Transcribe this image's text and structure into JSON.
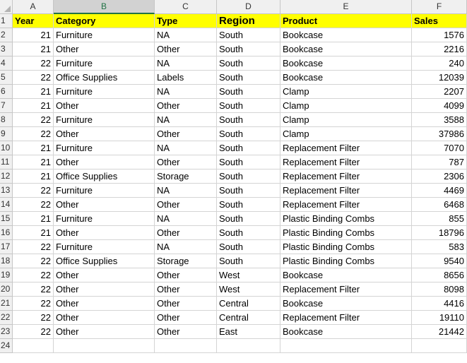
{
  "columns": [
    "A",
    "B",
    "C",
    "D",
    "E",
    "F"
  ],
  "header": {
    "year": "Year",
    "category": "Category",
    "type": "Type",
    "region": "Region",
    "product": "Product",
    "sales": "Sales"
  },
  "rows": [
    {
      "year": "21",
      "category": "Furniture",
      "type": "NA",
      "region": "South",
      "product": "Bookcase",
      "sales": "1576"
    },
    {
      "year": "21",
      "category": "Other",
      "type": "Other",
      "region": "South",
      "product": "Bookcase",
      "sales": "2216"
    },
    {
      "year": "22",
      "category": "Furniture",
      "type": "NA",
      "region": "South",
      "product": "Bookcase",
      "sales": "240"
    },
    {
      "year": "22",
      "category": "Office Supplies",
      "type": "Labels",
      "region": "South",
      "product": "Bookcase",
      "sales": "12039"
    },
    {
      "year": "21",
      "category": "Furniture",
      "type": "NA",
      "region": "South",
      "product": "Clamp",
      "sales": "2207"
    },
    {
      "year": "21",
      "category": "Other",
      "type": "Other",
      "region": "South",
      "product": "Clamp",
      "sales": "4099"
    },
    {
      "year": "22",
      "category": "Furniture",
      "type": "NA",
      "region": "South",
      "product": "Clamp",
      "sales": "3588"
    },
    {
      "year": "22",
      "category": "Other",
      "type": "Other",
      "region": "South",
      "product": "Clamp",
      "sales": "37986"
    },
    {
      "year": "21",
      "category": "Furniture",
      "type": "NA",
      "region": "South",
      "product": "Replacement Filter",
      "sales": "7070"
    },
    {
      "year": "21",
      "category": "Other",
      "type": "Other",
      "region": "South",
      "product": "Replacement Filter",
      "sales": "787"
    },
    {
      "year": "21",
      "category": "Office Supplies",
      "type": "Storage",
      "region": "South",
      "product": "Replacement Filter",
      "sales": "2306"
    },
    {
      "year": "22",
      "category": "Furniture",
      "type": "NA",
      "region": "South",
      "product": "Replacement Filter",
      "sales": "4469"
    },
    {
      "year": "22",
      "category": "Other",
      "type": "Other",
      "region": "South",
      "product": "Replacement Filter",
      "sales": "6468"
    },
    {
      "year": "21",
      "category": "Furniture",
      "type": "NA",
      "region": "South",
      "product": "Plastic Binding Combs",
      "sales": "855"
    },
    {
      "year": "21",
      "category": "Other",
      "type": "Other",
      "region": "South",
      "product": "Plastic Binding Combs",
      "sales": "18796"
    },
    {
      "year": "22",
      "category": "Furniture",
      "type": "NA",
      "region": "South",
      "product": "Plastic Binding Combs",
      "sales": "583"
    },
    {
      "year": "22",
      "category": "Office Supplies",
      "type": "Storage",
      "region": "South",
      "product": "Plastic Binding Combs",
      "sales": "9540"
    },
    {
      "year": "22",
      "category": "Other",
      "type": "Other",
      "region": "West",
      "product": "Bookcase",
      "sales": "8656"
    },
    {
      "year": "22",
      "category": "Other",
      "type": "Other",
      "region": "West",
      "product": "Replacement Filter",
      "sales": "8098"
    },
    {
      "year": "22",
      "category": "Other",
      "type": "Other",
      "region": "Central",
      "product": "Bookcase",
      "sales": "4416"
    },
    {
      "year": "22",
      "category": "Other",
      "type": "Other",
      "region": "Central",
      "product": "Replacement Filter",
      "sales": "19110"
    },
    {
      "year": "22",
      "category": "Other",
      "type": "Other",
      "region": "East",
      "product": "Bookcase",
      "sales": "21442"
    }
  ],
  "row_numbers": [
    "1",
    "2",
    "3",
    "4",
    "5",
    "6",
    "7",
    "8",
    "9",
    "10",
    "11",
    "12",
    "13",
    "14",
    "15",
    "16",
    "17",
    "18",
    "19",
    "20",
    "21",
    "22",
    "23",
    "24"
  ],
  "selected_column": "B",
  "colors": {
    "header_fill": "#ffff00",
    "selected_header": "#217346"
  }
}
